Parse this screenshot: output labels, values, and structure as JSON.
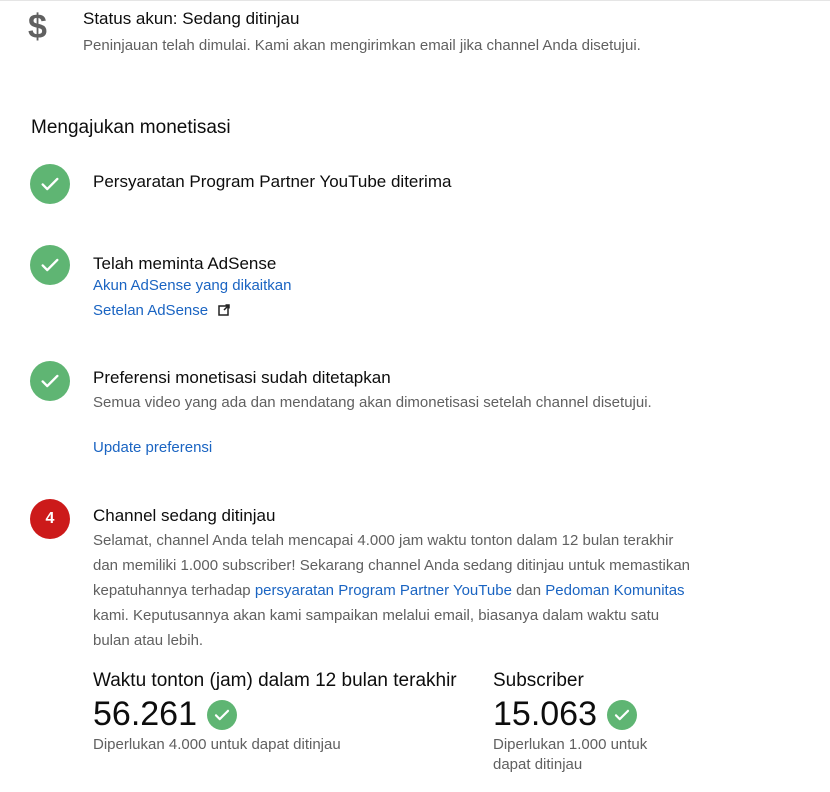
{
  "status": {
    "icon": "dollar-icon",
    "title": "Status akun: Sedang ditinjau",
    "description": "Peninjauan telah dimulai. Kami akan mengirimkan email jika channel Anda disetujui."
  },
  "section_title": "Mengajukan monetisasi",
  "steps": [
    {
      "icon": "check-icon",
      "title": "Persyaratan Program Partner YouTube diterima"
    },
    {
      "icon": "check-icon",
      "title": "Telah meminta AdSense",
      "link1": "Akun AdSense yang dikaitkan",
      "link2": "Setelan AdSense"
    },
    {
      "icon": "check-icon",
      "title": "Preferensi monetisasi sudah ditetapkan",
      "description": "Semua video yang ada dan mendatang akan dimonetisasi setelah channel disetujui.",
      "link": "Update preferensi"
    },
    {
      "number": "4",
      "title": "Channel sedang ditinjau",
      "desc_part1": "Selamat, channel Anda telah mencapai 4.000 jam waktu tonton dalam 12 bulan terakhir dan memiliki 1.000 subscriber! Sekarang channel Anda sedang ditinjau untuk memastikan kepatuhannya terhadap ",
      "desc_link1": "persyaratan Program Partner YouTube",
      "desc_part2": " dan ",
      "desc_link2": "Pedoman Komunitas",
      "desc_part3": " kami. Keputusannya akan kami sampaikan melalui email, biasanya dalam waktu satu bulan atau lebih."
    }
  ],
  "stats": {
    "watch": {
      "title": "Waktu tonton (jam) dalam 12 bulan terakhir",
      "value": "56.261",
      "note": "Diperlukan 4.000 untuk dapat ditinjau"
    },
    "subs": {
      "title": "Subscriber",
      "value": "15.063",
      "note": "Diperlukan 1.000 untuk dapat ditinjau"
    }
  },
  "colors": {
    "check_green": "#5fb573",
    "step_red": "#cc1a1a",
    "link_blue": "#1a64c2"
  }
}
